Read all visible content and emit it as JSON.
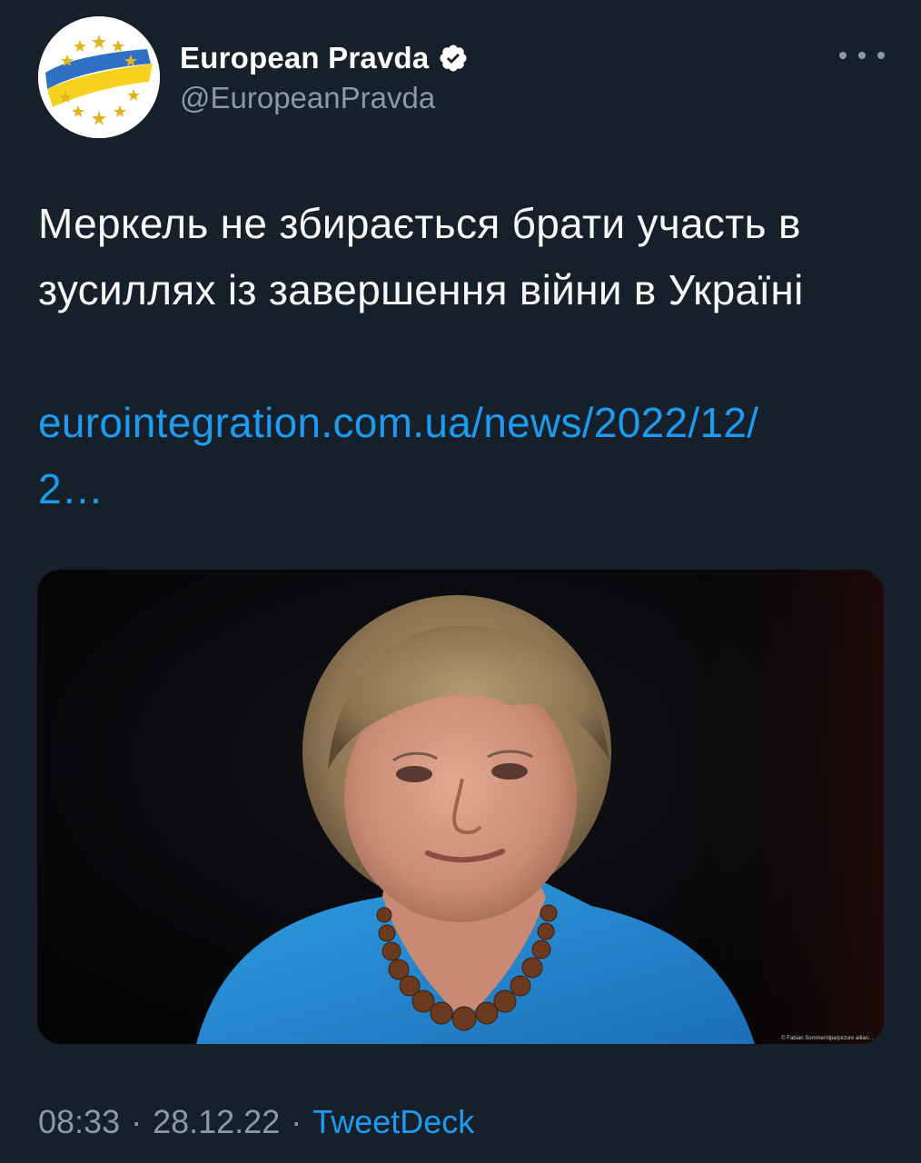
{
  "author": {
    "display_name": "European Pravda",
    "handle": "@EuropeanPravda",
    "verified": true,
    "avatar_icon": "eu-flag-stars-logo"
  },
  "menu": {
    "icon": "more-horizontal-icon"
  },
  "tweet": {
    "text": "Меркель не збирається брати участь в зусиллях із завершення війни в Україні",
    "link_display": "eurointegration.com.ua/news/2022/12/2…"
  },
  "media": {
    "photo_credit": "© Fabian Sommer/dpa/picture allian..."
  },
  "footer": {
    "time": "08:33",
    "separator": "·",
    "date": "28.12.22",
    "source": "TweetDeck"
  },
  "colors": {
    "background": "#15202b",
    "text": "#f7f9f9",
    "secondary": "#8b98a5",
    "accent": "#1d9bf0"
  }
}
